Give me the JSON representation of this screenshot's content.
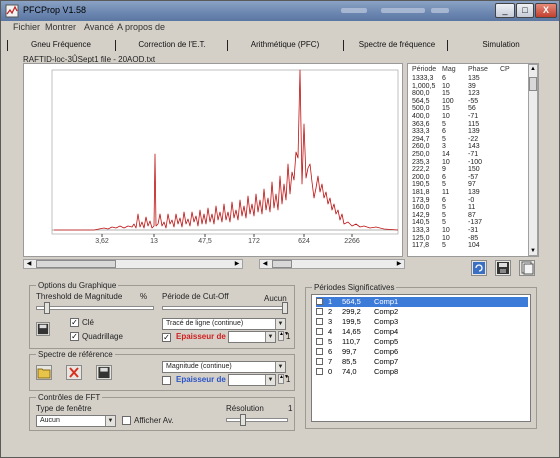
{
  "window": {
    "title": "PFCProp V1.58",
    "buttons": {
      "minimize": "_",
      "maximize": "□",
      "close": "X"
    }
  },
  "menu": [
    "Fichier",
    "Montrer",
    "Avancé",
    "A propos de"
  ],
  "tabs": [
    "Gneu Fréquence",
    "Correction de l'E.T.",
    "Arithmétique (PFC)",
    "Spectre de fréquence",
    "Simulation"
  ],
  "file_path": "RAFTID-loc-3ÛSept1 file - 20AOD.txt",
  "chart": {
    "x_tick_labels": [
      "3,62",
      "13",
      "47,5",
      "172",
      "624",
      "2266"
    ],
    "line_color": "#c01010"
  },
  "period_table": {
    "headers": [
      "Période",
      "Mag",
      "Phase",
      "CP"
    ],
    "rows": [
      [
        "1333,3",
        "6",
        "135",
        ""
      ],
      [
        "1,000,5",
        "10",
        "39",
        ""
      ],
      [
        "800,0",
        "15",
        "123",
        ""
      ],
      [
        "564,5",
        "100",
        "-55",
        ""
      ],
      [
        "500,0",
        "15",
        "56",
        ""
      ],
      [
        "400,0",
        "10",
        "-71",
        ""
      ],
      [
        "363,6",
        "5",
        "115",
        ""
      ],
      [
        "333,3",
        "6",
        "139",
        ""
      ],
      [
        "294,7",
        "5",
        "-22",
        ""
      ],
      [
        "260,0",
        "3",
        "143",
        ""
      ],
      [
        "250,0",
        "14",
        "-71",
        ""
      ],
      [
        "235,3",
        "10",
        "-100",
        ""
      ],
      [
        "222,2",
        "9",
        "150",
        ""
      ],
      [
        "200,0",
        "6",
        "-57",
        ""
      ],
      [
        "190,5",
        "5",
        "97",
        ""
      ],
      [
        "181,8",
        "11",
        "139",
        ""
      ],
      [
        "173,9",
        "6",
        "-0",
        ""
      ],
      [
        "160,0",
        "5",
        "11",
        ""
      ],
      [
        "142,9",
        "5",
        "87",
        ""
      ],
      [
        "140,5",
        "5",
        "-137",
        ""
      ],
      [
        "133,3",
        "10",
        "-31",
        ""
      ],
      [
        "125,0",
        "10",
        "-85",
        ""
      ],
      [
        "117,8",
        "5",
        "104",
        ""
      ]
    ]
  },
  "graph_options": {
    "title": "Options du Graphique",
    "threshold_label": "Threshold de Magnitude",
    "threshold_unit": "%",
    "cutoff_label": "Période de Cut-Off",
    "cutoff_value": "Aucun",
    "check_cle": "Clé",
    "check_grid": "Quadrillage",
    "curve_type": "Tracé de ligne (continue)",
    "line_thickness_label": "Epaisseur de ligne",
    "line_thickness_value": "1"
  },
  "reference_spectrum": {
    "title": "Spectre de référence",
    "curve_type": "Magnitude (continue)",
    "line_thickness_label": "Epaisseur de ligne",
    "line_thickness_value": "1"
  },
  "fft_controls": {
    "title": "Contrôles de FFT",
    "window_type_label": "Type de fenêtre",
    "window_type_value": "Aucun",
    "show_av": "Afficher Av.",
    "resolution_label": "Résolution",
    "resolution_value": "1"
  },
  "significant_periods": {
    "title": "Périodes Significatives",
    "rows": [
      {
        "n": "1",
        "period": "564,5",
        "name": "Comp1",
        "selected": true
      },
      {
        "n": "2",
        "period": "299,2",
        "name": "Comp2",
        "selected": false
      },
      {
        "n": "3",
        "period": "199,5",
        "name": "Comp3",
        "selected": false
      },
      {
        "n": "4",
        "period": "14,65",
        "name": "Comp4",
        "selected": false
      },
      {
        "n": "5",
        "period": "110,7",
        "name": "Comp5",
        "selected": false
      },
      {
        "n": "6",
        "period": "99,7",
        "name": "Comp6",
        "selected": false
      },
      {
        "n": "7",
        "period": "85,5",
        "name": "Comp7",
        "selected": false
      },
      {
        "n": "0",
        "period": "74,0",
        "name": "Comp8",
        "selected": false
      }
    ]
  },
  "icons": {
    "chart_tools": [
      "refresh-icon",
      "save-icon",
      "copy-icon"
    ],
    "reference_tools": [
      "open-folder-icon",
      "delete-icon",
      "save-icon"
    ]
  }
}
